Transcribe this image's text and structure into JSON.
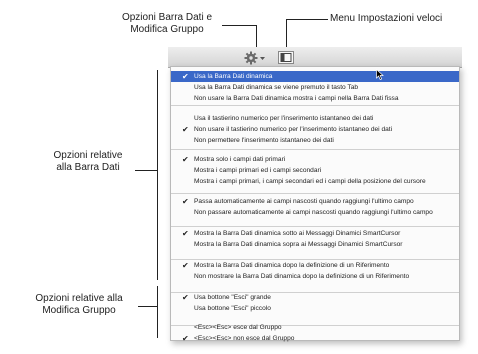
{
  "annotations": {
    "gear_label_line1": "Opzioni Barra Dati e",
    "gear_label_line2": "Modifica Gruppo",
    "quick_settings_label": "Menu Impostazioni veloci",
    "data_bar_options_line1": "Opzioni relative",
    "data_bar_options_line2": "alla Barra Dati",
    "group_edit_options_line1": "Opzioni relative alla",
    "group_edit_options_line2": "Modifica Gruppo"
  },
  "toolbar": {
    "gear_icon": "gear-icon",
    "quick_settings_icon": "panel-icon"
  },
  "menu": {
    "check_glyph": "✔",
    "highlight_color": "#3a68c8",
    "items": [
      {
        "label": "Usa la Barra Dati dinamica",
        "checked": true,
        "highlighted": true
      },
      {
        "label": "Usa la Barra Dati dinamica se viene premuto il tasto Tab",
        "checked": false
      },
      {
        "label": "Non usare la Barra Dati dinamica  mostra i campi nella Barra Dati fissa",
        "checked": false
      },
      {
        "label": "Usa il tastierino numerico per l'inserimento istantaneo dei dati",
        "checked": false
      },
      {
        "label": "Non usare il tastierino numerico per l'inserimento istantaneo dei dati",
        "checked": true
      },
      {
        "label": "Non permettere l'inserimento istantaneo dei dati",
        "checked": false
      },
      {
        "label": "Mostra solo i campi dati primari",
        "checked": true
      },
      {
        "label": "Mostra i campi primari ed i campi secondari",
        "checked": false
      },
      {
        "label": "Mostra i campi primari, i campi secondari ed i campi della posizione del cursore",
        "checked": false
      },
      {
        "label": "Passa automaticamente ai campi nascosti quando raggiungi l'ultimo campo",
        "checked": true
      },
      {
        "label": "Non passare automaticamente ai campi nascosti quando raggiungi l'ultimo campo",
        "checked": false
      },
      {
        "label": "Mostra la Barra Dati dinamica sotto ai Messaggi Dinamici SmartCursor",
        "checked": true
      },
      {
        "label": "Mostra la Barra Dati dinamica sopra ai Messaggi Dinamici SmartCursor",
        "checked": false
      },
      {
        "label": "Mostra la Barra Dati dinamica dopo la definizione di un Riferimento",
        "checked": true
      },
      {
        "label": "Non mostrare la Barra Dati dinamica dopo la definizione di un Riferimento",
        "checked": false
      },
      {
        "label": "Usa bottone \"Esci\" grande",
        "checked": true
      },
      {
        "label": "Usa bottone \"Esci\" piccolo",
        "checked": false
      },
      {
        "label": "<Esc><Esc> esce dal Gruppo",
        "checked": false
      },
      {
        "label": "<Esc><Esc> non esce dal Gruppo",
        "checked": true
      }
    ]
  }
}
